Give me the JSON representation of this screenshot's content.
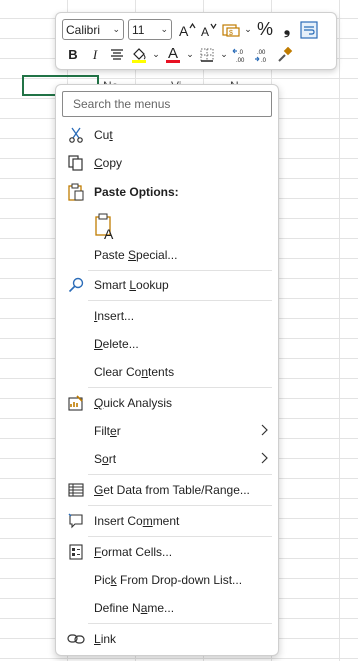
{
  "colors": {
    "accent": "#217346",
    "highlight": "#ffff00",
    "font_color": "#e81123",
    "icon_blue": "#2b6cb8"
  },
  "sheet": {
    "cell_fragments": [
      "Ne",
      "Vi",
      "N"
    ]
  },
  "toolbar": {
    "font_name": "Calibri",
    "font_size": "11",
    "increase_font": "A^",
    "decrease_font": "Aˇ",
    "percent": "%",
    "comma": "❟",
    "bold": "B",
    "italic": "I",
    "font_color_letter": "A"
  },
  "search": {
    "placeholder": "Search the menus"
  },
  "menu": {
    "cut": {
      "pre": "Cu",
      "key": "t",
      "post": ""
    },
    "copy": {
      "pre": "",
      "key": "C",
      "post": "opy"
    },
    "paste_options": "Paste Options:",
    "paste_special": {
      "pre": "Paste ",
      "key": "S",
      "post": "pecial..."
    },
    "smart_lookup": {
      "pre": "Smart ",
      "key": "L",
      "post": "ookup"
    },
    "insert": {
      "pre": "",
      "key": "I",
      "post": "nsert..."
    },
    "delete": {
      "pre": "",
      "key": "D",
      "post": "elete..."
    },
    "clear_contents": {
      "pre": "Clear Co",
      "key": "n",
      "post": "tents"
    },
    "quick_analysis": {
      "pre": "",
      "key": "Q",
      "post": "uick Analysis"
    },
    "filter": {
      "pre": "Filt",
      "key": "e",
      "post": "r"
    },
    "sort": {
      "pre": "S",
      "key": "o",
      "post": "rt"
    },
    "get_data": {
      "pre": "",
      "key": "G",
      "post": "et Data from Table/Range..."
    },
    "insert_comment": {
      "pre": "Insert Co",
      "key": "m",
      "post": "ment"
    },
    "format_cells": {
      "pre": "",
      "key": "F",
      "post": "ormat Cells..."
    },
    "pick_list": {
      "pre": "Pic",
      "key": "k",
      "post": " From Drop-down List..."
    },
    "define_name": {
      "pre": "Define N",
      "key": "a",
      "post": "me..."
    },
    "link": {
      "pre": "",
      "key": "L",
      "post": "ink"
    }
  }
}
